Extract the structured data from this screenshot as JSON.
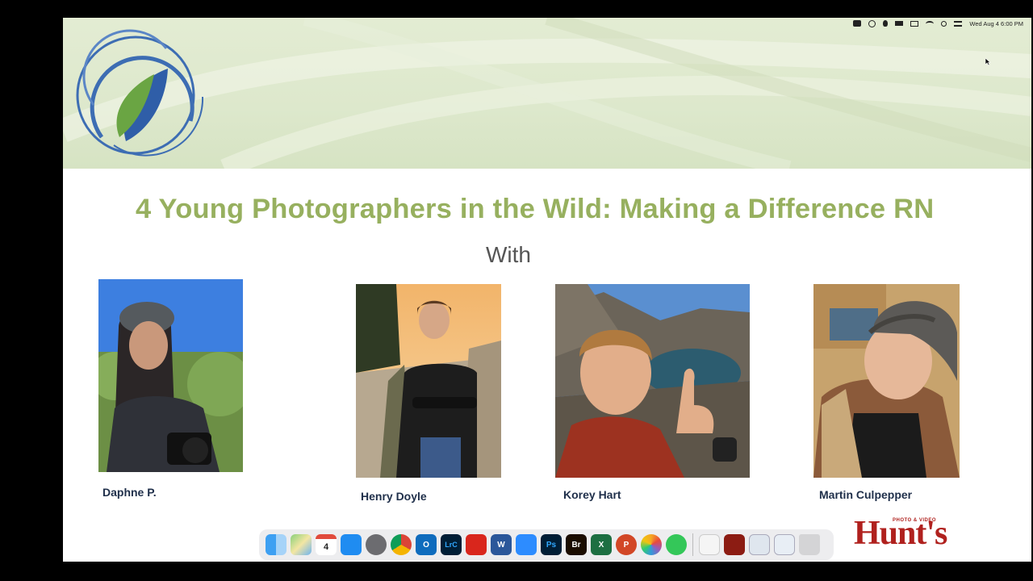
{
  "menubar": {
    "icons": [
      "screen-record-icon",
      "creative-cloud-icon",
      "dropbox-icon",
      "truck-icon",
      "display-icon",
      "wifi-icon",
      "search-icon",
      "control-center-icon"
    ],
    "clock": "Wed Aug 4  6:00 PM"
  },
  "slide": {
    "title": "4 Young Photographers in the Wild: Making a Difference RN",
    "subtitle": "With",
    "accent_color": "#97b05f",
    "photographers": [
      {
        "name": "Daphne P."
      },
      {
        "name": "Henry Doyle"
      },
      {
        "name": "Korey Hart"
      },
      {
        "name": "Martin Culpepper"
      }
    ]
  },
  "dock": {
    "apps": [
      {
        "name": "Finder",
        "label": ""
      },
      {
        "name": "Maps",
        "label": ""
      },
      {
        "name": "Calendar",
        "label": "4"
      },
      {
        "name": "App Store",
        "label": ""
      },
      {
        "name": "System Preferences",
        "label": ""
      },
      {
        "name": "Chrome",
        "label": ""
      },
      {
        "name": "Outlook",
        "label": "O"
      },
      {
        "name": "Lightroom Classic",
        "label": "LrC"
      },
      {
        "name": "Acrobat",
        "label": ""
      },
      {
        "name": "Word",
        "label": "W"
      },
      {
        "name": "Zoom",
        "label": ""
      },
      {
        "name": "Photoshop",
        "label": "Ps"
      },
      {
        "name": "Bridge",
        "label": "Br"
      },
      {
        "name": "Excel",
        "label": "X"
      },
      {
        "name": "PowerPoint",
        "label": "P"
      },
      {
        "name": "Photos",
        "label": ""
      },
      {
        "name": "Messages",
        "label": ""
      }
    ],
    "recent": [
      "Calendar document",
      "PDF folder",
      "Window preview",
      "Window preview"
    ],
    "trash": "Trash"
  },
  "logo": {
    "brand_small": "PHOTO & VIDEO",
    "brand": "Hunt's"
  }
}
